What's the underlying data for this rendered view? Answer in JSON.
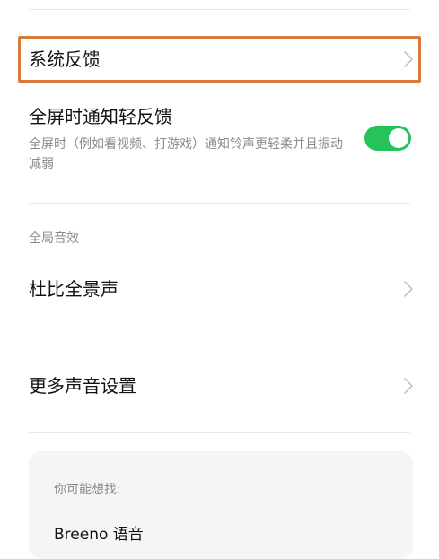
{
  "settings": {
    "system_feedback": {
      "label": "系统反馈"
    },
    "fullscreen_notify": {
      "title": "全屏时通知轻反馈",
      "description": "全屏时（例如看视频、打游戏）通知铃声更轻柔并且振动减弱",
      "enabled": true
    },
    "global_sound_section": {
      "label": "全局音效"
    },
    "dolby": {
      "label": "杜比全景声"
    },
    "more_sound": {
      "label": "更多声音设置"
    }
  },
  "suggestions": {
    "title": "你可能想找:",
    "items": [
      "Breeno 语音"
    ]
  },
  "colors": {
    "toggle_on": "#26c35b",
    "highlight": "#d77a3c",
    "secondary_text": "#8b8b8b"
  },
  "icons": {
    "chevron": "chevron-right-icon"
  }
}
